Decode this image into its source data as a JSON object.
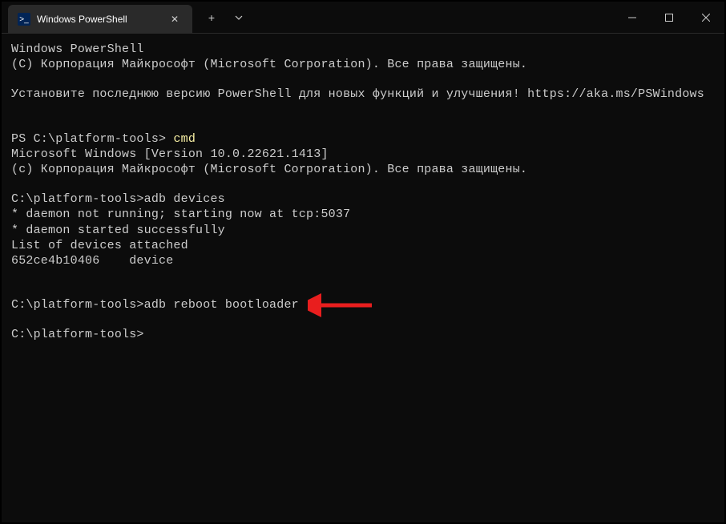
{
  "window": {
    "tab_title": "Windows PowerShell",
    "tab_icon_label": ">_"
  },
  "terminal": {
    "lines": {
      "l1": "Windows PowerShell",
      "l2": "(C) Корпорация Майкрософт (Microsoft Corporation). Все права защищены.",
      "l3": "Установите последнюю версию PowerShell для новых функций и улучшения! https://aka.ms/PSWindows",
      "l4_prompt": "PS C:\\platform-tools> ",
      "l4_cmd": "cmd",
      "l5": "Microsoft Windows [Version 10.0.22621.1413]",
      "l6": "(c) Корпорация Майкрософт (Microsoft Corporation). Все права защищены.",
      "l7": "C:\\platform-tools>adb devices",
      "l8": "* daemon not running; starting now at tcp:5037",
      "l9": "* daemon started successfully",
      "l10": "List of devices attached",
      "l11": "652ce4b10406    device",
      "l12": "C:\\platform-tools>adb reboot bootloader",
      "l13": "C:\\platform-tools>"
    }
  },
  "annotation": {
    "arrow_color": "#e91e1e"
  }
}
